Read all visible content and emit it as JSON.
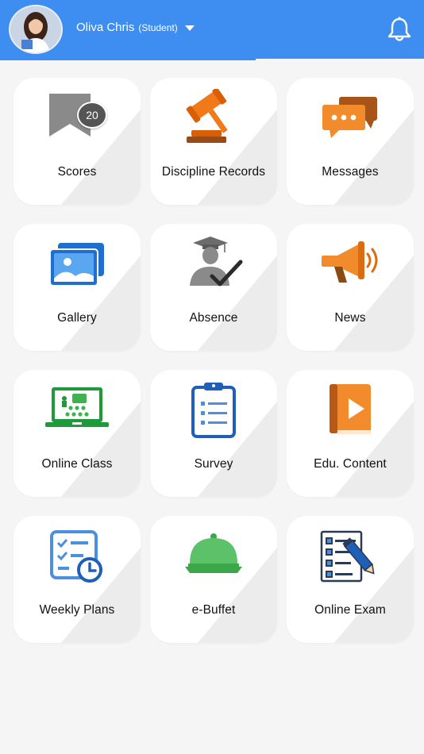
{
  "header": {
    "user_name": "Oliva Chris",
    "user_role": "(Student)",
    "avatar_icon": "student-avatar",
    "notification_icon": "bell-icon",
    "bg_color": "#3d8ef0"
  },
  "tiles": [
    {
      "label": "Scores",
      "icon": "bookmark-icon",
      "badge": "20"
    },
    {
      "label": "Discipline Records",
      "icon": "gavel-icon"
    },
    {
      "label": "Messages",
      "icon": "chat-bubbles-icon"
    },
    {
      "label": "Gallery",
      "icon": "photos-icon"
    },
    {
      "label": "Absence",
      "icon": "graduate-check-icon"
    },
    {
      "label": "News",
      "icon": "megaphone-icon"
    },
    {
      "label": "Online Class",
      "icon": "online-class-icon"
    },
    {
      "label": "Survey",
      "icon": "clipboard-icon"
    },
    {
      "label": "Edu. Content",
      "icon": "play-book-icon"
    },
    {
      "label": "Weekly Plans",
      "icon": "checklist-clock-icon"
    },
    {
      "label": "e-Buffet",
      "icon": "serving-dish-icon"
    },
    {
      "label": "Online Exam",
      "icon": "exam-pencil-icon"
    }
  ]
}
